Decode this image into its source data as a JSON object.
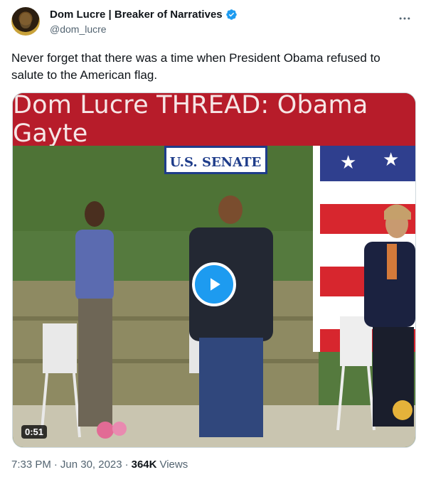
{
  "author": {
    "name": "Dom Lucre | Breaker of Narratives",
    "handle": "@dom_lucre",
    "verified_color": "#1d9bf0"
  },
  "tweet": {
    "text": "Never forget that there was a time when President Obama refused to salute to the American flag."
  },
  "media": {
    "type": "video",
    "banner_text": "Dom Lucre THREAD: Obama Gayte",
    "sign_text": "U.S. SENATE",
    "duration": "0:51",
    "banner_color": "#b71c2a",
    "play_icon": "play-icon"
  },
  "meta": {
    "time": "7:33 PM",
    "separator1": "·",
    "date": "Jun 30, 2023",
    "separator2": "·",
    "views_count": "364K",
    "views_label": "Views"
  }
}
